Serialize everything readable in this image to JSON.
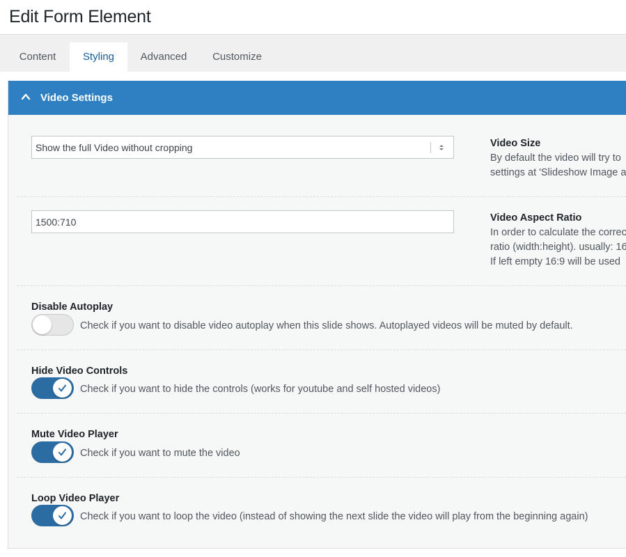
{
  "header": {
    "title": "Edit Form Element"
  },
  "tabs": [
    {
      "label": "Content",
      "active": false
    },
    {
      "label": "Styling",
      "active": true
    },
    {
      "label": "Advanced",
      "active": false
    },
    {
      "label": "Customize",
      "active": false
    }
  ],
  "section": {
    "title": "Video Settings",
    "expanded": true,
    "accent_color": "#2e80c2"
  },
  "video_size": {
    "selected_value": "Show the full Video without cropping",
    "title": "Video Size",
    "desc_line1": "By default the video will try to",
    "desc_line2": "settings at 'Slideshow Image a"
  },
  "aspect_ratio": {
    "value": "1500:710",
    "title": "Video Aspect Ratio",
    "desc_line1": "In order to calculate the correc",
    "desc_line2": "ratio (width:height). usually: 16",
    "desc_line3": "If left empty 16:9 will be used"
  },
  "options": {
    "autoplay": {
      "title": "Disable Autoplay",
      "checked": false,
      "desc": "Check if you want to disable video autoplay when this slide shows. Autoplayed videos will be muted by default."
    },
    "controls": {
      "title": "Hide Video Controls",
      "checked": true,
      "desc": "Check if you want to hide the controls (works for youtube and self hosted videos)"
    },
    "mute": {
      "title": "Mute Video Player",
      "checked": true,
      "desc": "Check if you want to mute the video"
    },
    "loop": {
      "title": "Loop Video Player",
      "checked": true,
      "desc": "Check if you want to loop the video (instead of showing the next slide the video will play from the beginning again)"
    }
  },
  "icons": {
    "collapse": "chevron-up-icon",
    "select_arrows": "sort-arrows-icon",
    "toggle_on": "checkmark-icon"
  },
  "colors": {
    "toggle_on": "#2b6ca3",
    "active_tab_text": "#135e96"
  }
}
